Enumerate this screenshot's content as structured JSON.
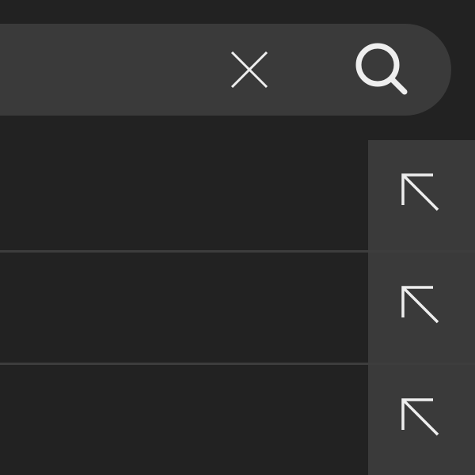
{
  "search": {
    "value": "",
    "placeholder": "",
    "clear_icon": "close-icon",
    "search_icon": "search-icon"
  },
  "suggestions": [
    {
      "text": "",
      "fill_icon": "arrow-up-left-icon"
    },
    {
      "text": "",
      "fill_icon": "arrow-up-left-icon"
    },
    {
      "text": "",
      "fill_icon": "arrow-up-left-icon"
    }
  ],
  "colors": {
    "background": "#222222",
    "surface": "#3a3a3a",
    "divider": "#3d3d3d",
    "icon": "#eeeeee"
  }
}
